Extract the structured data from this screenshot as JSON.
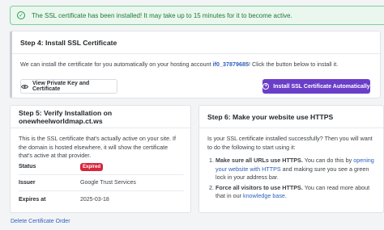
{
  "alert": {
    "icon": "check-circle-icon",
    "text": "The SSL certificate has been installed! It may take up to 15 minutes for it to become active."
  },
  "step4": {
    "title": "Step 4: Install SSL Certificate",
    "desc_before": "We can install the certificate for you automatically on your hosting account ",
    "account": "if0_37879685",
    "desc_after": "! Click the button below to install it.",
    "view_button": "View Private Key and Certificate",
    "install_button": "Install SSL Certificate Automatically"
  },
  "step5": {
    "title": "Step 5: Verify Installation on onewheelworldmap.ct.ws",
    "desc": "This is the SSL certificate that's actually active on your site. If the domain is hosted elsewhere, it will show the certificate that's active at that provider.",
    "rows": [
      {
        "label": "Status",
        "value": "Expired"
      },
      {
        "label": "Issuer",
        "value": "Google Trust Services"
      },
      {
        "label": "Expires at",
        "value": "2025-03-18"
      }
    ]
  },
  "step6": {
    "title": "Step 6: Make your website use HTTPS",
    "intro": "Is your SSL certificate installed successfully? Then you will want to do the following to start using it:",
    "item1_bold": "Make sure all URLs use HTTPS.",
    "item1_text": " You can do this by ",
    "item1_link": "opening your website with HTTPS",
    "item1_rest": " and making sure you see a green lock in your address bar.",
    "item2_bold": "Force all visitors to use HTTPS.",
    "item2_text": " You can read more about that in our ",
    "item2_link": "knowledge base",
    "item2_rest": "."
  },
  "footer": {
    "delete_link": "Delete Certificate Order"
  },
  "colors": {
    "accent": "#6a3ec9",
    "success": "#1e7a3c",
    "danger": "#d7263d",
    "link": "#2d5fbe"
  }
}
